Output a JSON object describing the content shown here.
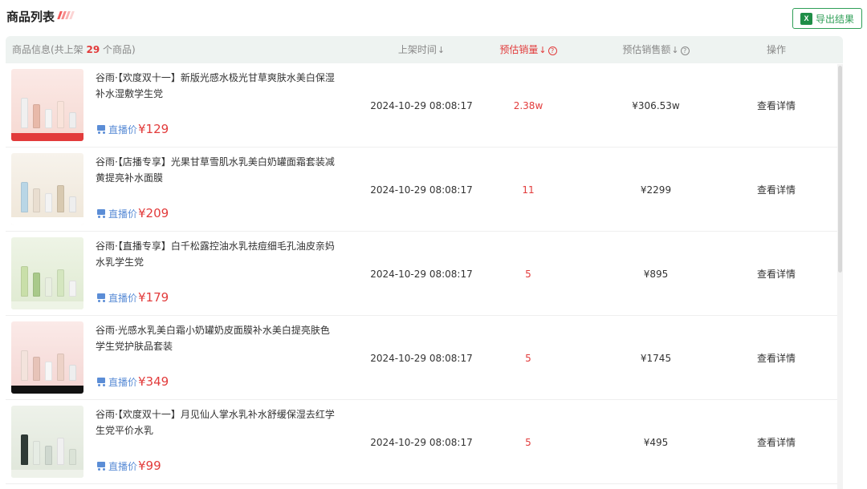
{
  "header": {
    "title": "商品列表",
    "export_label": "导出结果",
    "export_icon": "excel-icon"
  },
  "columns": {
    "info_prefix": "商品信息(共上架 ",
    "info_count": "29",
    "info_suffix": " 个商品)",
    "time": "上架时间",
    "sales": "预估销量",
    "amount": "预估销售额",
    "op": "操作"
  },
  "price_label": "直播价",
  "detail_label": "查看详情",
  "colors": {
    "accent_red": "#e23b3b",
    "header_bg": "#eef3f1",
    "export_green": "#2e9e56",
    "price_blue": "#5b8dd6"
  },
  "rows": [
    {
      "name": "谷雨·【欢度双十一】新版光感水极光甘草爽肤水美白保湿补水湿敷学生党",
      "price": "¥129",
      "time": "2024-10-29 08:08:17",
      "sales": "2.38w",
      "amount": "¥306.53w"
    },
    {
      "name": "谷雨·【店播专享】光果甘草雪肌水乳美白奶罐面霜套装减黄提亮补水面膜",
      "price": "¥209",
      "time": "2024-10-29 08:08:17",
      "sales": "11",
      "amount": "¥2299"
    },
    {
      "name": "谷雨·【直播专享】白千松露控油水乳祛痘细毛孔油皮亲妈水乳学生党",
      "price": "¥179",
      "time": "2024-10-29 08:08:17",
      "sales": "5",
      "amount": "¥895"
    },
    {
      "name": "谷雨·光感水乳美白霜小奶罐奶皮面膜补水美白提亮肤色学生党护肤品套装",
      "price": "¥349",
      "time": "2024-10-29 08:08:17",
      "sales": "5",
      "amount": "¥1745"
    },
    {
      "name": "谷雨·【欢度双十一】月见仙人掌水乳补水舒缓保湿去红学生党平价水乳",
      "price": "¥99",
      "time": "2024-10-29 08:08:17",
      "sales": "5",
      "amount": "¥495"
    }
  ]
}
